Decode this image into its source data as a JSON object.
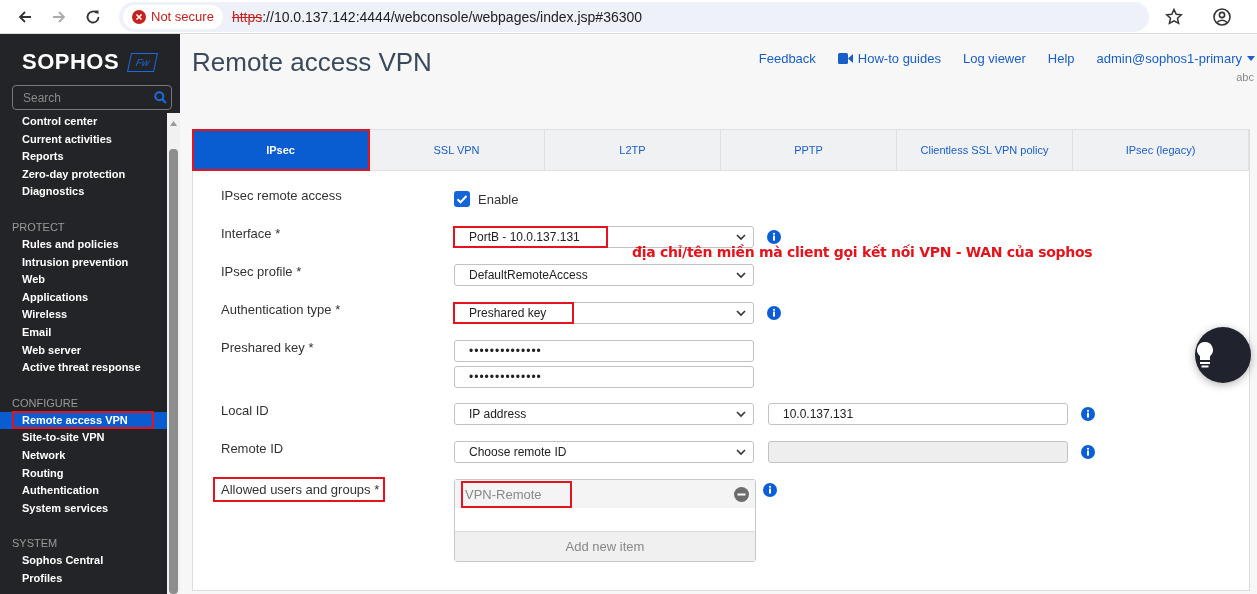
{
  "browser": {
    "security_label": "Not secure",
    "url_scheme": "https",
    "url_rest": "://10.0.137.142:4444/webconsole/webpages/index.jsp#36300"
  },
  "sidebar": {
    "logo": "SOPHOS",
    "logo_badge": "Fw",
    "search": {
      "placeholder": "Search"
    },
    "sections": [
      {
        "items": [
          {
            "label": "Control center",
            "selected": false,
            "highlighted": false
          },
          {
            "label": "Current activities",
            "selected": false,
            "highlighted": false
          },
          {
            "label": "Reports",
            "selected": false,
            "highlighted": false
          },
          {
            "label": "Zero-day protection",
            "selected": false,
            "highlighted": false
          },
          {
            "label": "Diagnostics",
            "selected": false,
            "highlighted": false
          }
        ]
      },
      {
        "heading": "PROTECT",
        "items": [
          {
            "label": "Rules and policies",
            "selected": false,
            "highlighted": false
          },
          {
            "label": "Intrusion prevention",
            "selected": false,
            "highlighted": false
          },
          {
            "label": "Web",
            "selected": false,
            "highlighted": false
          },
          {
            "label": "Applications",
            "selected": false,
            "highlighted": false
          },
          {
            "label": "Wireless",
            "selected": false,
            "highlighted": false
          },
          {
            "label": "Email",
            "selected": false,
            "highlighted": false
          },
          {
            "label": "Web server",
            "selected": false,
            "highlighted": false
          },
          {
            "label": "Active threat response",
            "selected": false,
            "highlighted": false
          }
        ]
      },
      {
        "heading": "CONFIGURE",
        "items": [
          {
            "label": "Remote access VPN",
            "selected": true,
            "highlighted": true
          },
          {
            "label": "Site-to-site VPN",
            "selected": false,
            "highlighted": false
          },
          {
            "label": "Network",
            "selected": false,
            "highlighted": false
          },
          {
            "label": "Routing",
            "selected": false,
            "highlighted": false
          },
          {
            "label": "Authentication",
            "selected": false,
            "highlighted": false
          },
          {
            "label": "System services",
            "selected": false,
            "highlighted": false
          }
        ]
      },
      {
        "heading": "SYSTEM",
        "items": [
          {
            "label": "Sophos Central",
            "selected": false,
            "highlighted": false
          },
          {
            "label": "Profiles",
            "selected": false,
            "highlighted": false
          }
        ]
      }
    ]
  },
  "header": {
    "title": "Remote access VPN",
    "links": [
      {
        "label": "Feedback",
        "kind": "link"
      },
      {
        "label": "How-to guides",
        "kind": "video"
      },
      {
        "label": "Log viewer",
        "kind": "link"
      },
      {
        "label": "Help",
        "kind": "link"
      },
      {
        "label": "admin@sophos1-primary",
        "kind": "menu"
      }
    ],
    "user_sub": "abc"
  },
  "tabs": [
    {
      "label": "IPsec",
      "selected": true,
      "highlighted": true
    },
    {
      "label": "SSL VPN",
      "selected": false,
      "highlighted": false
    },
    {
      "label": "L2TP",
      "selected": false,
      "highlighted": false
    },
    {
      "label": "PPTP",
      "selected": false,
      "highlighted": false
    },
    {
      "label": "Clientless SSL VPN policy",
      "selected": false,
      "highlighted": false
    },
    {
      "label": "IPsec (legacy)",
      "selected": false,
      "highlighted": false
    }
  ],
  "form": {
    "rows": [
      {
        "kind": "checkbox",
        "label": "IPsec remote access",
        "checked": true,
        "text": "Enable"
      },
      {
        "kind": "select",
        "label": "Interface *",
        "value": "PortB - 10.0.137.131",
        "value_highlighted": true,
        "info": true
      },
      {
        "kind": "select",
        "label": "IPsec profile *",
        "value": "DefaultRemoteAccess",
        "value_highlighted": false
      },
      {
        "kind": "select",
        "label": "Authentication type *",
        "value": "Preshared key",
        "value_highlighted": true,
        "info": true
      },
      {
        "kind": "password",
        "label": "Preshared key *",
        "values": [
          "••••••••••••••",
          "••••••••••••••"
        ]
      },
      {
        "kind": "select_with_input",
        "label": "Local ID",
        "value": "IP address",
        "input_value": "10.0.137.131",
        "input_disabled": false,
        "info": true
      },
      {
        "kind": "select_with_input",
        "label": "Remote ID",
        "value": "Choose remote ID",
        "input_disabled": true,
        "info": true
      },
      {
        "kind": "list",
        "label": "Allowed users and groups *",
        "label_highlighted": true,
        "items": [
          {
            "text": "VPN-Remote",
            "highlighted": true
          }
        ],
        "add_label": "Add new item",
        "info": true
      }
    ],
    "annotation": "địa chỉ/tên miền mà client gọi kết nối VPN - WAN của sophos"
  }
}
